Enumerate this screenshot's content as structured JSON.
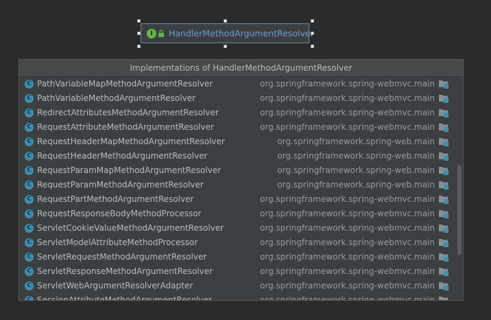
{
  "node": {
    "badge": "I",
    "title": "HandlerMethodArgumentResolver",
    "icon": "interface-icon"
  },
  "popup": {
    "title": "Implementations of HandlerMethodArgumentResolver",
    "rows": [
      {
        "name": "PathVariableMapMethodArgumentResolver",
        "module": "org.springframework.spring-webmvc.main"
      },
      {
        "name": "PathVariableMethodArgumentResolver",
        "module": "org.springframework.spring-webmvc.main"
      },
      {
        "name": "RedirectAttributesMethodArgumentResolver",
        "module": "org.springframework.spring-webmvc.main"
      },
      {
        "name": "RequestAttributeMethodArgumentResolver",
        "module": "org.springframework.spring-webmvc.main"
      },
      {
        "name": "RequestHeaderMapMethodArgumentResolver",
        "module": "org.springframework.spring-web.main"
      },
      {
        "name": "RequestHeaderMethodArgumentResolver",
        "module": "org.springframework.spring-web.main"
      },
      {
        "name": "RequestParamMapMethodArgumentResolver",
        "module": "org.springframework.spring-web.main"
      },
      {
        "name": "RequestParamMethodArgumentResolver",
        "module": "org.springframework.spring-web.main"
      },
      {
        "name": "RequestPartMethodArgumentResolver",
        "module": "org.springframework.spring-webmvc.main"
      },
      {
        "name": "RequestResponseBodyMethodProcessor",
        "module": "org.springframework.spring-webmvc.main"
      },
      {
        "name": "ServletCookieValueMethodArgumentResolver",
        "module": "org.springframework.spring-webmvc.main"
      },
      {
        "name": "ServletModelAttributeMethodProcessor",
        "module": "org.springframework.spring-webmvc.main"
      },
      {
        "name": "ServletRequestMethodArgumentResolver",
        "module": "org.springframework.spring-webmvc.main"
      },
      {
        "name": "ServletResponseMethodArgumentResolver",
        "module": "org.springframework.spring-webmvc.main"
      },
      {
        "name": "ServletWebArgumentResolverAdapter",
        "module": "org.springframework.spring-webmvc.main"
      },
      {
        "name": "SessionAttributeMethodArgumentResolver",
        "module": "org.springframework.spring-webmvc.main"
      }
    ],
    "class_badge": "C"
  },
  "colors": {
    "background": "#2b2b2b",
    "popup_bg": "#3c3f41",
    "class_icon": "#3d8fb3",
    "interface_icon": "#62b543",
    "node_title": "#6b9bd2"
  }
}
